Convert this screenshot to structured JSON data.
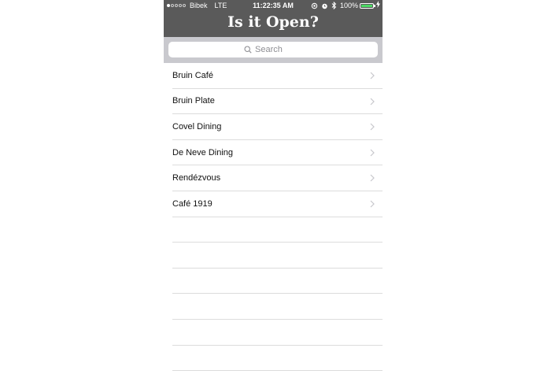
{
  "status_bar": {
    "carrier": "Bibek",
    "network": "LTE",
    "time": "11:22:35 AM",
    "battery_percent": "100%",
    "battery_level": 1.0,
    "signal_bars_filled": 1,
    "signal_bars_total": 5,
    "battery_color": "#4cd964"
  },
  "header": {
    "title": "Is it Open?",
    "background": "#5a5a5a"
  },
  "search": {
    "placeholder": "Search",
    "icon": "search-icon"
  },
  "dining_list": {
    "items": [
      {
        "label": "Bruin Café"
      },
      {
        "label": "Bruin Plate"
      },
      {
        "label": "Covel Dining"
      },
      {
        "label": "De Neve Dining"
      },
      {
        "label": "Rendézvous"
      },
      {
        "label": "Café 1919"
      }
    ],
    "chevron_icon": "chevron-right-icon"
  }
}
